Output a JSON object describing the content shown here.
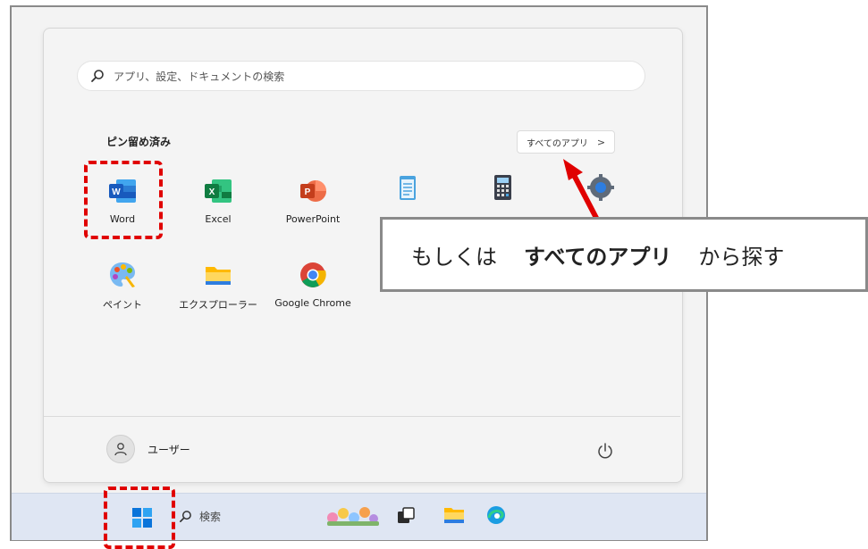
{
  "search": {
    "placeholder": "アプリ、設定、ドキュメントの検索"
  },
  "pinned": {
    "heading": "ピン留め済み",
    "all_apps_label": "すべてのアプリ",
    "all_apps_chevron": ">",
    "apps": [
      {
        "label": "Word",
        "icon": "word-icon"
      },
      {
        "label": "Excel",
        "icon": "excel-icon"
      },
      {
        "label": "PowerPoint",
        "icon": "powerpoint-icon"
      },
      {
        "label": "",
        "icon": "notepad-icon"
      },
      {
        "label": "",
        "icon": "calculator-icon"
      },
      {
        "label": "",
        "icon": "settings-icon"
      },
      {
        "label": "ペイント",
        "icon": "paint-icon"
      },
      {
        "label": "エクスプローラー",
        "icon": "folder-icon"
      },
      {
        "label": "Google Chrome",
        "icon": "chrome-icon"
      }
    ]
  },
  "user": {
    "name": "ユーザー"
  },
  "taskbar": {
    "search_label": "検索"
  },
  "callout": {
    "prefix": "もしくは",
    "emphasis": "すべてのアプリ",
    "suffix": "から探す"
  },
  "colors": {
    "highlight": "#e00000",
    "accent": "#0067c0"
  }
}
